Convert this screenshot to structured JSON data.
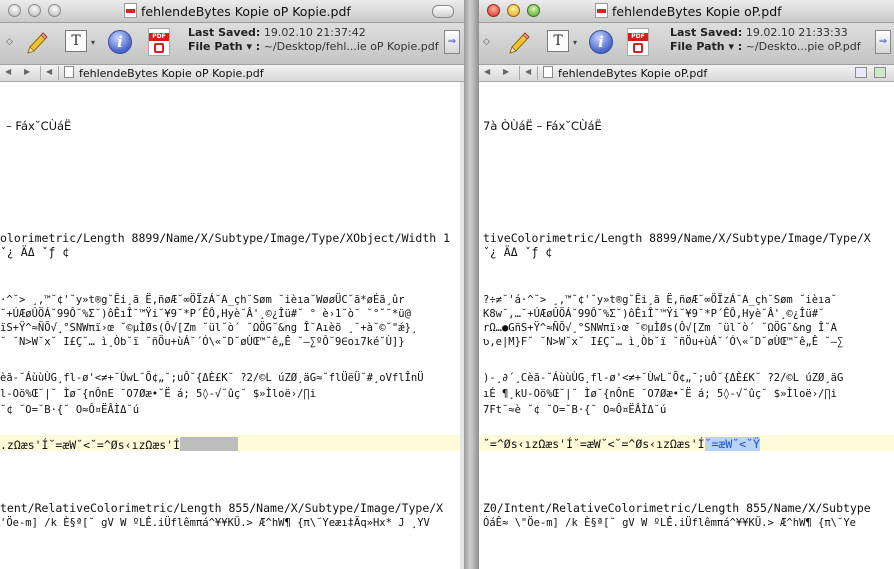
{
  "left": {
    "title": "fehlendeBytes Kopie oP Kopie.pdf",
    "last_saved_label": "Last Saved:",
    "last_saved_value": "19.02.10 21:37:42",
    "file_path_label": "File Path ▾ :",
    "file_path_value": "~/Desktop/fehl...ie oP Kopie.pdf",
    "tab_name": "fehlendeBytes Kopie oP Kopie.pdf",
    "lines": [
      "– Fáx˘CÙáË",
      "olorimetric/Length 8899/Name/X/Subtype/Image/Type/XObject/Width 1",
      "                              ˇ¿ ÄΔ        ˇƒ ¢",
      "·^˘>  ¸,™˘¢'˘y»t®g˘Ëi¸ã Ë,ñøÆ˘∞ÖÏzÁ˘A_çh˘Søm ˘ièıa˘WøøÜC˘ã*øÉã¸ûr",
      "˘+ÚÆøÛÖÁ˘99Ô˘%Σ˘)ôÊıÎ˘™Ÿi˘¥9˘*P´ÊÔ,Hyè˘Â'¸©¿Îü#˘ ° è›1˘ò˘ ˘°˘˘*ü@",
      "ïS+Ÿ^≈ÑÕ√¸°SNWπï›œ ˘©µÌØs(Ô√[Zm ˘ül˘ò´ ˘ΩÖG˘&ng Î˘Aıèõ ¸˘+à˘©˘\"ǽ}¸",
      "˘ ˘N>W˘x˘ I£Ç˘… ì¸Òb˘ï  ˘ñÖu+ùÁ˘´Ó\\«˘D˘øÙŒ™˘ê„Ê ˘–∑ºÔ˘9∈oı7ké˘Ù]}",
      "èã-˘ÁùùÙG¸fl-ø'<≠+˘ÙwL˘Õ¢„˘;uÔ˘{ΔÈ£K˘ ?2/©L úZØ¸äG≈˘flÜëÜ˘#¸oVflÎnÜ",
      "l-Oö%Œ˘|˘ Ìø˘{nÔnE ˘O7Øæ•˘Ë á; 5◊-√˘ûç˘ $»Ìloë›/∏i",
      " ˘¢ ˘O=˘B·{˘ O≈Ô¤ËÂÌΔ˘ú",
      ".zΩæs'Í˘=æW˘<˘=^Øs‹ızΩæs'Í",
      "tent/RelativeColorimetric/Length 855/Name/X/Subtype/Image/Type/X",
      "'Öe-m] /k È§ª[˘ gV W ºLÊ.iÜflêmπá^¥¥KÜ.> Æ^hW¶ {π\\˘Yeæı‡Äq»Hx* J ¸YV"
    ]
  },
  "right": {
    "title": "fehlendeBytes Kopie oP.pdf",
    "last_saved_label": "Last Saved:",
    "last_saved_value": "19.02.10 21:33:33",
    "file_path_label": "File Path ▾ :",
    "file_path_value": "~/Deskto...pie oP.pdf",
    "tab_name": "fehlendeBytes Kopie oP.pdf",
    "lines": [
      "7à ÒÙáË – Fáx˘CÙáË",
      "tiveColorimetric/Length 8899/Name/X/Subtype/Image/Type/X",
      "                       ˇ¿ ÄΔ        ˇƒ ¢",
      "?÷≠˘'á·^˘>  ¸,™˘¢'˘y»t®g˘Ëi¸ã Ë,ñøÆ˘∞ÖÏzÁ˘A_çh˘Søm ˘ièıa˘",
      "K8w˘,…˘+ÚÆøÛÖÁ˘99Ô˘%Σ˘)ôÊıÎ˘™Ÿi˘¥9˘*P´ÊÔ,Hyè˘Â'¸©¿Îü#˘",
      "rΩ…●GñS+Ÿ^≈ÑÕ√¸°SNWπï›œ ˘©µÌØs(Ô√[Zm ˘ül˘ò´ ˘ΩÖG˘&ng Î˘A",
      "ʋ,e|M}F˘ ˘N>W˘x˘ I£Ç˘… ì¸Òb˘ï  ˘ñÖu+ùÁ˘´Ó\\«˘D˘øÙŒ™˘ê„Ê ˘–∑",
      ")-¸∂´¸Cèã-˘ÁùùÙG¸fl-ø'<≠+˘ÙwL˘Õ¢„˘;uÔ˘{ΔÈ£K˘ ?2/©L úZØ¸äG",
      "ıÉ ¶¸kU-Oö%Œ˘|˘ Ìø˘{nÔnE ˘O7Øæ•˘Ë á; 5◊-√˘ûç˘ $»Ìloë›/∏i",
      "7Ft˘≈è ˘¢ ˘O=˘B·{˘ O≈Ô¤ËÂÌΔ˘ú",
      "˘=^Øs‹ızΩæs'Í˘=æW˘<˘=^Øs‹ızΩæs'Í",
      "˘=æW˘<˘Ÿ",
      " Z0/Intent/RelativeColorimetric/Length 855/Name/X/Subtype",
      "ÓáÊ≈ \\\"Öe-m] /k È§ª[˘ gV W ºLÊ.iÜflêmπá^¥¥KÜ.> Æ^hW¶ {π\\˘Ye"
    ]
  }
}
